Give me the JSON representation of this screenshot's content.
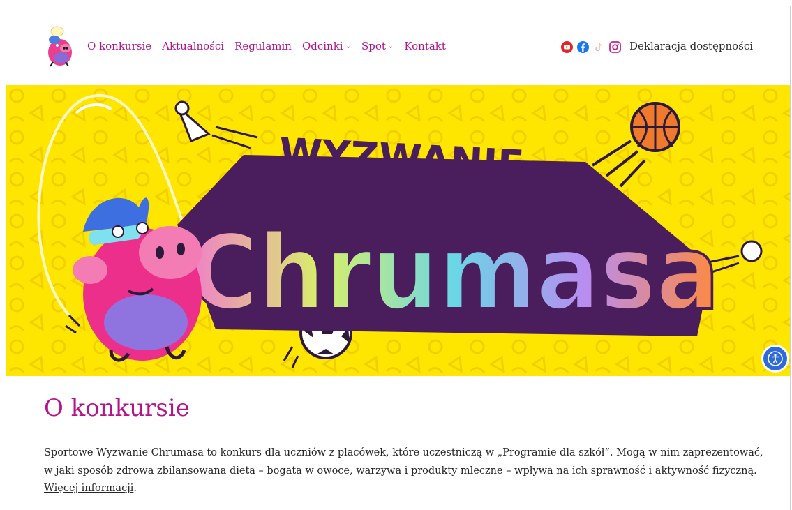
{
  "header": {
    "nav": [
      {
        "label": "O konkursie",
        "dropdown": false
      },
      {
        "label": "Aktualności",
        "dropdown": false
      },
      {
        "label": "Regulamin",
        "dropdown": false
      },
      {
        "label": "Odcinki",
        "dropdown": true
      },
      {
        "label": "Spot",
        "dropdown": true
      },
      {
        "label": "Kontakt",
        "dropdown": false
      }
    ],
    "social_icons": [
      "youtube-icon",
      "facebook-icon",
      "tiktok-icon",
      "instagram-icon"
    ],
    "accessibility_link": "Deklaracja dostępności"
  },
  "banner": {
    "line1": "WYZWANIE",
    "line2": "Chrumasa"
  },
  "main": {
    "title": "O konkursie",
    "paragraph": "Sportowe Wyzwanie Chrumasa to konkurs dla uczniów z placówek, które uczestniczą w „Programie dla szkół”. Mogą w nim zaprezentować, w jaki sposób zdrowa zbilansowana dieta – bogata w owoce, warzywa i produkty mleczne – wpływa na ich sprawność i aktywność fizyczną.",
    "more_link": "Więcej informacji",
    "more_suffix": "."
  },
  "colors": {
    "accent": "#b3148a",
    "banner_bg": "#ffe600",
    "a11y_button": "#2f6bd8"
  }
}
